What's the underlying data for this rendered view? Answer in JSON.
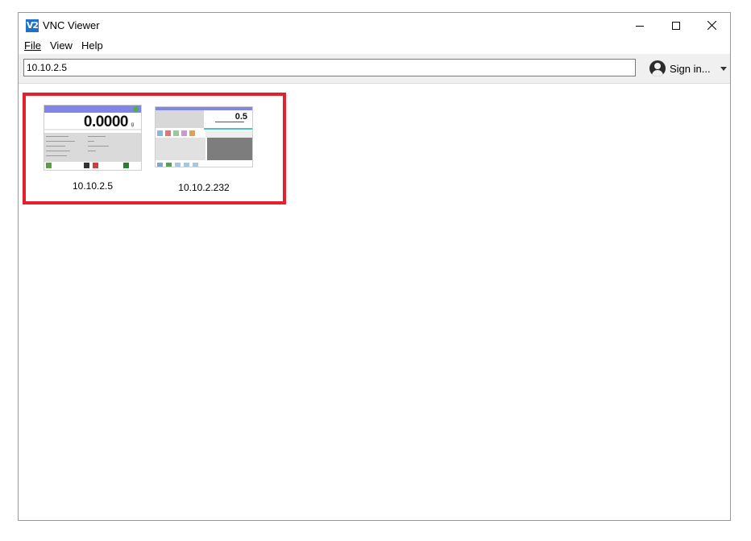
{
  "window": {
    "title": "VNC Viewer",
    "icon_text": "V2",
    "controls": [
      "minimize-icon",
      "maximize-icon",
      "close-icon"
    ]
  },
  "menu": {
    "file": "File",
    "view": "View",
    "help": "Help"
  },
  "toolbar": {
    "address_value": "10.10.2.5",
    "signin_label": "Sign in..."
  },
  "connections": [
    {
      "label": "10.10.2.5",
      "thumb_value": "0.0000",
      "thumb_unit": "g"
    },
    {
      "label": "10.10.2.232",
      "thumb_value": "0.5"
    }
  ],
  "colors": {
    "highlight": "#e3202b",
    "app_icon": "#1a73c9",
    "thumb_header": "#7f86e8"
  }
}
